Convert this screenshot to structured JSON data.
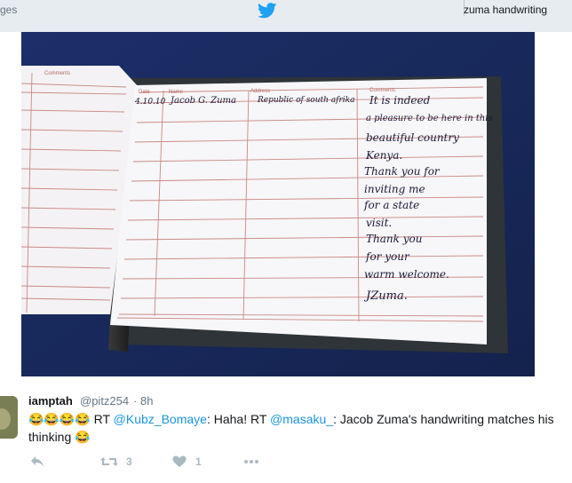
{
  "header": {
    "left_tab": "ges",
    "right_tab": "zuma handwriting",
    "brand_icon": "twitter-bird-icon"
  },
  "photo": {
    "left_page": {
      "header_label": "Comments"
    },
    "right_page": {
      "header_labels": [
        "Date",
        "Name",
        "Address",
        "Comments"
      ],
      "date_entry": "4.10.10",
      "name_entry": "Jacob G. Zuma",
      "address_entry": "Republic of south afrika",
      "comment_lines": [
        "It is indeed",
        "a pleasure to be here in this",
        "beautiful country",
        "Kenya.",
        "Thank you for",
        "inviting me",
        "for a state",
        "visit.",
        "Thank you",
        "for your",
        "warm welcome.",
        "JZuma."
      ]
    }
  },
  "tweet": {
    "display_name": "iamptah",
    "handle": "@pitz254",
    "separator": "·",
    "time": "8h",
    "emoji_prefix": "😂😂😂😂",
    "rt1": "RT",
    "mention1": "@Kubz_Bomaye",
    "text1": ": Haha! RT",
    "mention2": "@masaku_",
    "text2": ": Jacob Zuma's handwriting matches his thinking",
    "emoji_suffix": "😂",
    "retweet_count": "3",
    "like_count": "1",
    "icons": {
      "reply": "reply-icon",
      "retweet": "retweet-icon",
      "like": "heart-icon",
      "more": "more-icon"
    }
  }
}
